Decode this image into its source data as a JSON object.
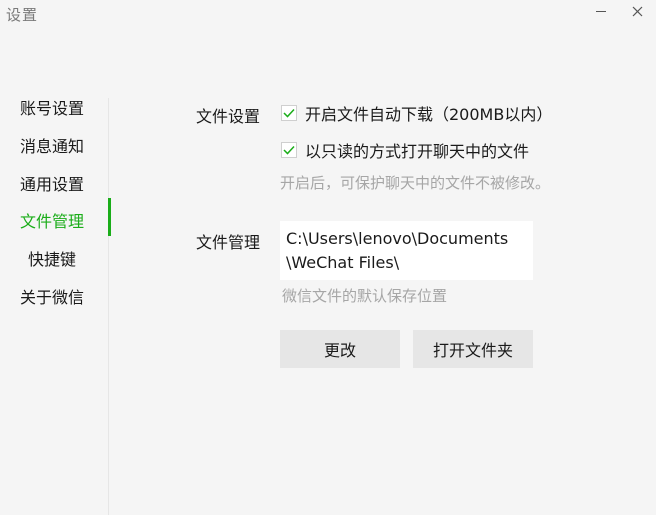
{
  "window": {
    "title": "设置",
    "minimize_glyph": "—",
    "close_glyph": "✕"
  },
  "sidebar": {
    "items": [
      {
        "label": "账号设置",
        "active": false
      },
      {
        "label": "消息通知",
        "active": false
      },
      {
        "label": "通用设置",
        "active": false
      },
      {
        "label": "文件管理",
        "active": true
      },
      {
        "label": "快捷键",
        "active": false
      },
      {
        "label": "关于微信",
        "active": false
      }
    ]
  },
  "file_settings": {
    "label": "文件设置",
    "auto_download": {
      "label": "开启文件自动下载（200MB以内）",
      "checked": true
    },
    "read_only": {
      "label": "以只读的方式打开聊天中的文件",
      "checked": true
    },
    "hint": "开启后，可保护聊天中的文件不被修改。"
  },
  "file_management": {
    "label": "文件管理",
    "path": "C:\\Users\\lenovo\\Documents\\WeChat Files\\",
    "hint": "微信文件的默认保存位置",
    "change_button": "更改",
    "open_folder_button": "打开文件夹"
  },
  "colors": {
    "accent": "#1aad19",
    "background": "#f5f5f5",
    "hint_text": "#a6a6a6",
    "button_bg": "#e6e6e6"
  }
}
